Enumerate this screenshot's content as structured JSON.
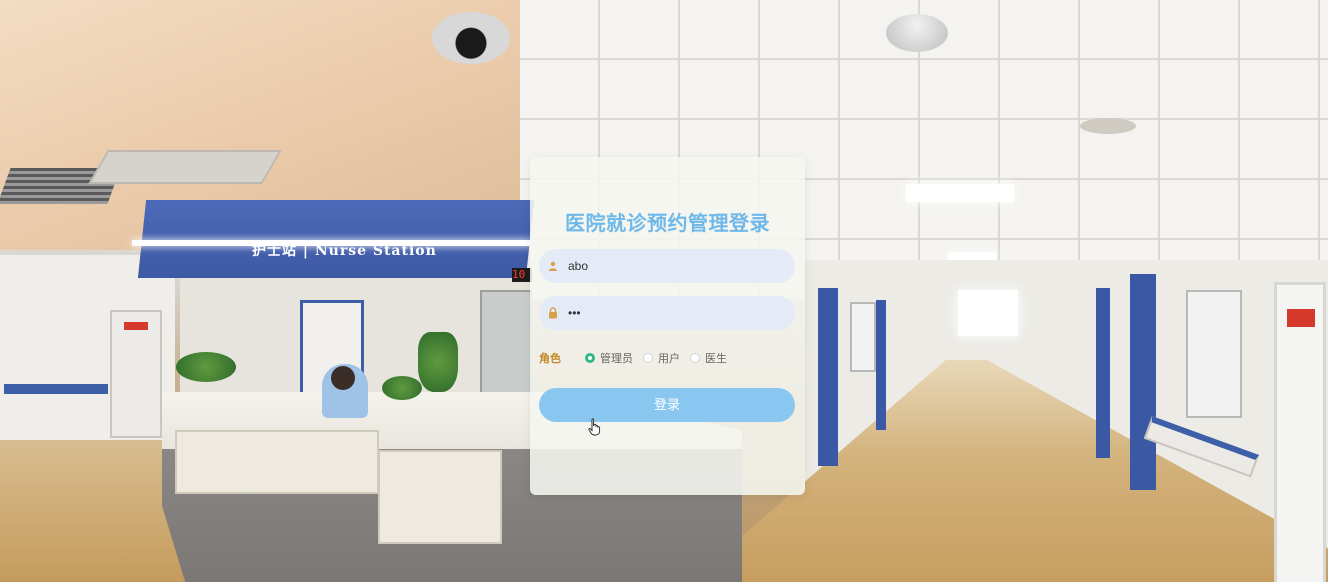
{
  "background": {
    "station_sign": "护士站 | Nurse Station",
    "floor_counter": "10"
  },
  "login": {
    "title": "医院就诊预约管理登录",
    "username_value": "abo",
    "password_value": "•••",
    "role_label": "角色",
    "roles": [
      {
        "label": "管理员",
        "checked": true
      },
      {
        "label": "用户",
        "checked": false
      },
      {
        "label": "医生",
        "checked": false
      }
    ],
    "submit_label": "登录"
  },
  "colors": {
    "title": "#6fb8ea",
    "button": "#89c7f0",
    "field_bg": "#e4ebf7",
    "radio_checked": "#2fb889",
    "role_label": "#c18a2a"
  },
  "icons": {
    "username": "user-icon",
    "password": "lock-icon",
    "cursor": "hand-pointer-icon"
  }
}
